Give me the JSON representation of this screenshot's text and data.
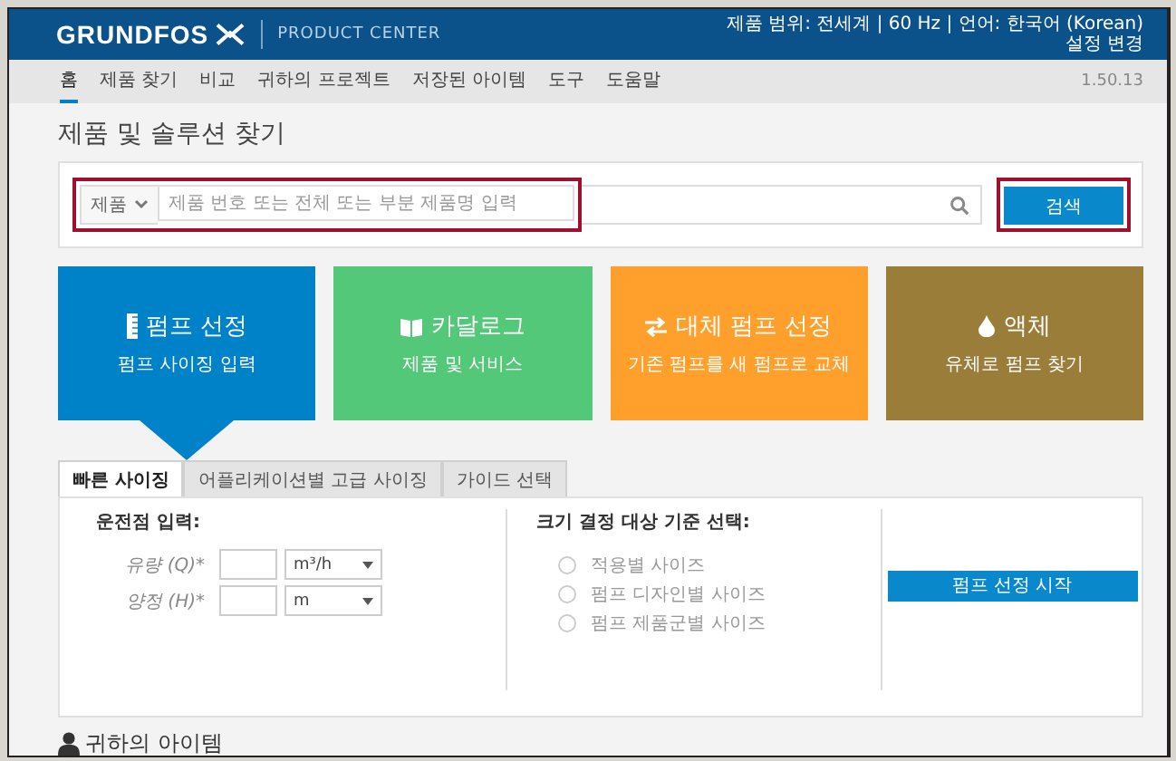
{
  "header": {
    "logo": "GRUNDFOS",
    "product": "PRODUCT CENTER",
    "settings": "제품 범위: 전세계 | 60 Hz | 언어: 한국어 (Korean)",
    "change_link": "설정 변경"
  },
  "nav": {
    "items": [
      {
        "label": "홈",
        "selected": true
      },
      {
        "label": "제품 찾기",
        "selected": false
      },
      {
        "label": "비교",
        "selected": false
      },
      {
        "label": "귀하의 프로젝트",
        "selected": false
      },
      {
        "label": "저장된 아이템",
        "selected": false
      },
      {
        "label": "도구",
        "selected": false
      },
      {
        "label": "도움말",
        "selected": false
      }
    ],
    "version": "1.50.13"
  },
  "page_title": "제품 및 솔루션 찾기",
  "search": {
    "scope": "제품",
    "placeholder": "제품 번호 또는 전체 또는 부분 제품명 입력",
    "button": "검색",
    "highlighted": true
  },
  "tiles": [
    {
      "kind": "sizing",
      "title": "펌프 선정",
      "subtitle": "펌프 사이징 입력",
      "color": "#0082c8",
      "selected": true
    },
    {
      "kind": "catalogue",
      "title": "카달로그",
      "subtitle": "제품 및 서비스",
      "color": "#52c878",
      "selected": false
    },
    {
      "kind": "replace",
      "title": "대체 펌프 선정",
      "subtitle": "기존 펌프를 새 펌프로 교체",
      "color": "#ffa02d",
      "selected": false
    },
    {
      "kind": "liquid",
      "title": "액체",
      "subtitle": "유체로 펌프 찾기",
      "color": "#9b7d3a",
      "selected": false
    }
  ],
  "tabs": [
    {
      "label": "빠른 사이징",
      "selected": true
    },
    {
      "label": "어플리케이션별 고급 사이징",
      "selected": false
    },
    {
      "label": "가이드 선택",
      "selected": false
    }
  ],
  "duty_point": {
    "heading": "운전점 입력:",
    "fields": [
      {
        "label": "유량 (Q)*",
        "unit": "m³/h"
      },
      {
        "label": "양정 (H)*",
        "unit": "m"
      }
    ]
  },
  "sizing_basis": {
    "heading": "크기 결정 대상 기준 선택:",
    "options": [
      {
        "label": "적용별 사이즈",
        "selected": false
      },
      {
        "label": "펌프 디자인별 사이즈",
        "selected": false
      },
      {
        "label": "펌프 제품군별 사이즈",
        "selected": false
      }
    ]
  },
  "start_button": "펌프 선정 시작",
  "your_items": "귀하의 아이템"
}
